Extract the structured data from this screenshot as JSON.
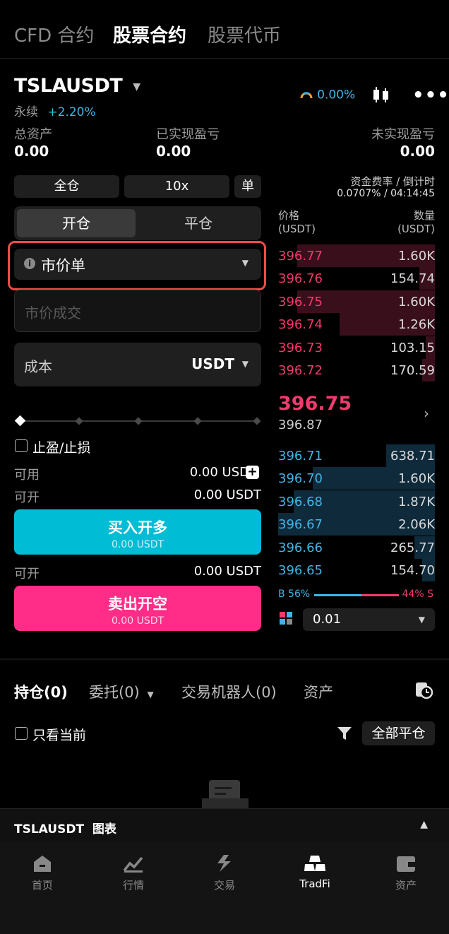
{
  "tabs": [
    "CFD 合约",
    "股票合约",
    "股票代币"
  ],
  "ticker": {
    "symbol": "TSLAUSDT",
    "type": "永续",
    "change": "+2.20%",
    "gauge_value": "0.00%"
  },
  "stats": {
    "total_assets_label": "总资产",
    "total_assets": "0.00",
    "realized_label": "已实现盈亏",
    "realized": "0.00",
    "unrealized_label": "未实现盈亏",
    "unrealized": "0.00"
  },
  "controls": {
    "margin_mode": "全仓",
    "leverage": "10x",
    "position_mode": "单",
    "open_tab": "开仓",
    "close_tab": "平仓",
    "order_type": "市价单",
    "price_placeholder": "市价成交",
    "cost_label": "成本",
    "cost_unit": "USDT",
    "tp_sl_label": "止盈/止损",
    "available_label": "可用",
    "available_value": "0.00 USDT",
    "can_open_label": "可开",
    "can_open_long": "0.00 USDT",
    "can_open_short": "0.00 USDT",
    "buy_label": "买入开多",
    "buy_sub": "0.00 USDT",
    "sell_label": "卖出开空",
    "sell_sub": "0.00 USDT"
  },
  "funding": {
    "label": "资金费率 / 倒计时",
    "value": "0.0707% / 04:14:45"
  },
  "orderbook": {
    "price_header": "价格",
    "price_unit": "(USDT)",
    "qty_header": "数量",
    "qty_unit": "(USDT)",
    "asks": [
      {
        "price": "396.77",
        "qty": "1.60K",
        "depth": 0.88
      },
      {
        "price": "396.76",
        "qty": "154.74",
        "depth": 0.1
      },
      {
        "price": "396.75",
        "qty": "1.60K",
        "depth": 0.88
      },
      {
        "price": "396.74",
        "qty": "1.26K",
        "depth": 0.61
      },
      {
        "price": "396.73",
        "qty": "103.15",
        "depth": 0.06
      },
      {
        "price": "396.72",
        "qty": "170.59",
        "depth": 0.08
      }
    ],
    "last_price": "396.75",
    "mark_price": "396.87",
    "bids": [
      {
        "price": "396.71",
        "qty": "638.71",
        "depth": 0.31
      },
      {
        "price": "396.70",
        "qty": "1.60K",
        "depth": 0.78
      },
      {
        "price": "396.68",
        "qty": "1.87K",
        "depth": 0.9
      },
      {
        "price": "396.67",
        "qty": "2.06K",
        "depth": 1.0
      },
      {
        "price": "396.66",
        "qty": "265.77",
        "depth": 0.13
      },
      {
        "price": "396.65",
        "qty": "154.70",
        "depth": 0.08
      }
    ],
    "buy_ratio": "B 56%",
    "sell_ratio": "44% S",
    "buy_fraction": 0.56,
    "precision": "0.01"
  },
  "positions": {
    "tabs": [
      "持仓(0)",
      "委托(0)",
      "交易机器人(0)",
      "资产"
    ],
    "only_current": "只看当前",
    "close_all": "全部平仓"
  },
  "chart_bar": {
    "label": "TSLAUSDT  图表"
  },
  "nav": [
    "首页",
    "行情",
    "交易",
    "TradFi",
    "资产"
  ],
  "colors": {
    "ask": "#f23a6d",
    "bid": "#3fb6e6",
    "buy_button": "#00bcd4",
    "sell_button": "#ff2d87",
    "highlight": "#f04a4a"
  }
}
